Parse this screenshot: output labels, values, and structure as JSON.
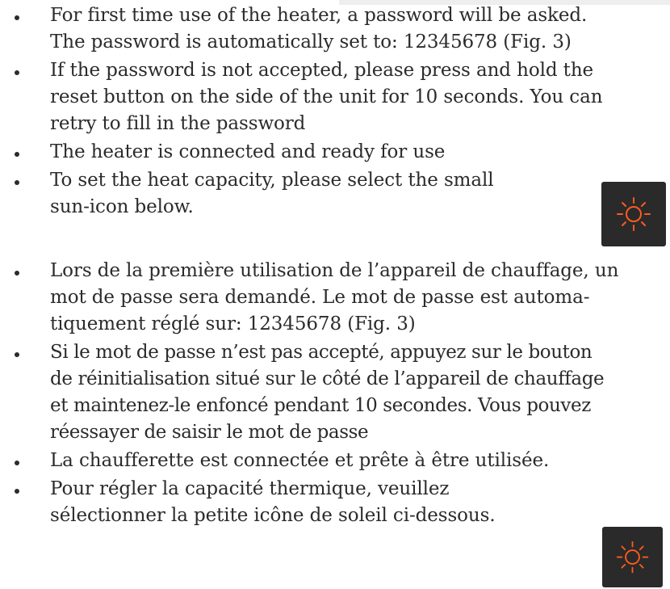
{
  "instructions_en": {
    "items": [
      "For first time use of the heater, a password will be asked.\nThe password is automatically set to: 12345678 (Fig. 3)",
      "If the password is not accepted, please press and hold the\nreset button on the side of the unit for 10 seconds. You can\nretry to fill in the password",
      "The heater is connected and ready for use",
      "To set the heat capacity, please select the small\nsun-icon below."
    ],
    "icon": "sun-icon"
  },
  "instructions_fr": {
    "items": [
      "Lors de la première utilisation de l’appareil de chauffage, un\nmot de passe sera demandé. Le mot de passe est automa-\ntiquement réglé sur: 12345678 (Fig. 3)",
      "Si le mot de passe n’est pas accepté, appuyez sur le bouton\nde réinitialisation situé sur le côté de l’appareil de chauffage\net maintenez-le enfoncé pendant 10 secondes. Vous pouvez\nréessayer de saisir le mot de passe",
      "La chaufferette est connectée et prête à être utilisée.",
      "Pour régler la capacité thermique, veuillez\nsélectionner la petite icône de soleil ci-dessous."
    ],
    "icon": "sun-icon"
  },
  "colors": {
    "text": "#2b2b2b",
    "icon_tile": "#2a2a2a",
    "icon_accent": "#ff5a1f"
  }
}
